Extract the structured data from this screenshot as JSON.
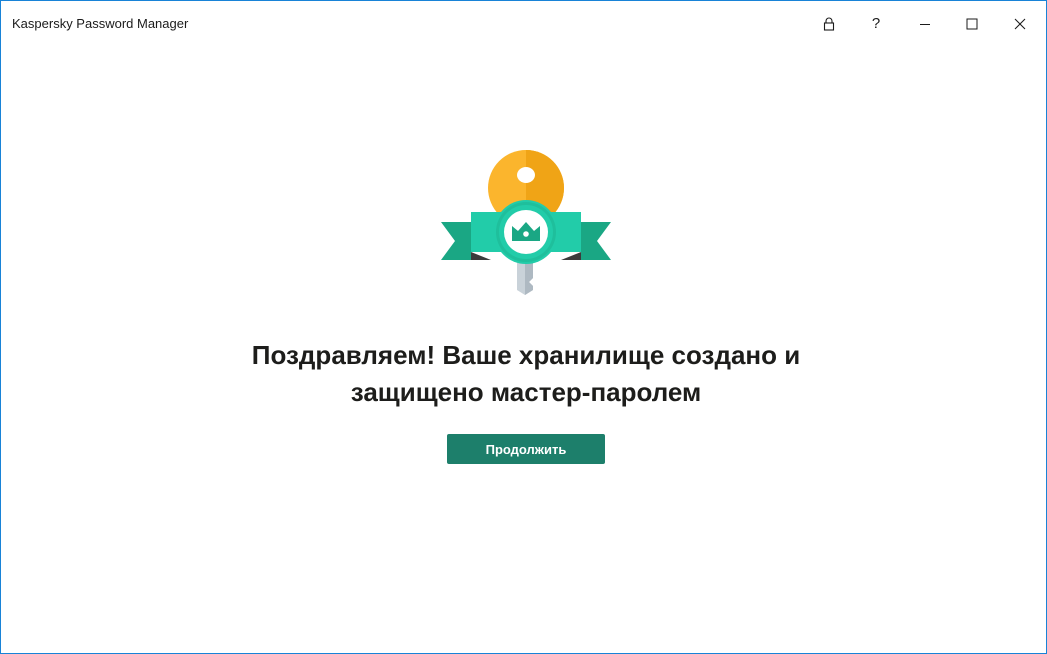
{
  "window": {
    "title": "Kaspersky Password Manager"
  },
  "titlebar": {
    "buttons": [
      {
        "name": "lock",
        "icon": "lock-icon"
      },
      {
        "name": "help",
        "label": "?"
      },
      {
        "name": "minimize",
        "icon": "minimize-icon"
      },
      {
        "name": "maximize",
        "icon": "maximize-icon"
      },
      {
        "name": "close",
        "icon": "close-icon"
      }
    ]
  },
  "main": {
    "illustration_icon": "key-with-crown-ribbon-icon",
    "headline_line1": "Поздравляем! Ваше хранилище создано и",
    "headline_line2": "защищено мастер-паролем",
    "continue_label": "Продолжить"
  },
  "colors": {
    "accent": "#1d7f6b",
    "key_gold": "#fbb52d",
    "ribbon_teal": "#1aa784",
    "badge_teal": "#22cca9",
    "window_border": "#1883d7"
  }
}
